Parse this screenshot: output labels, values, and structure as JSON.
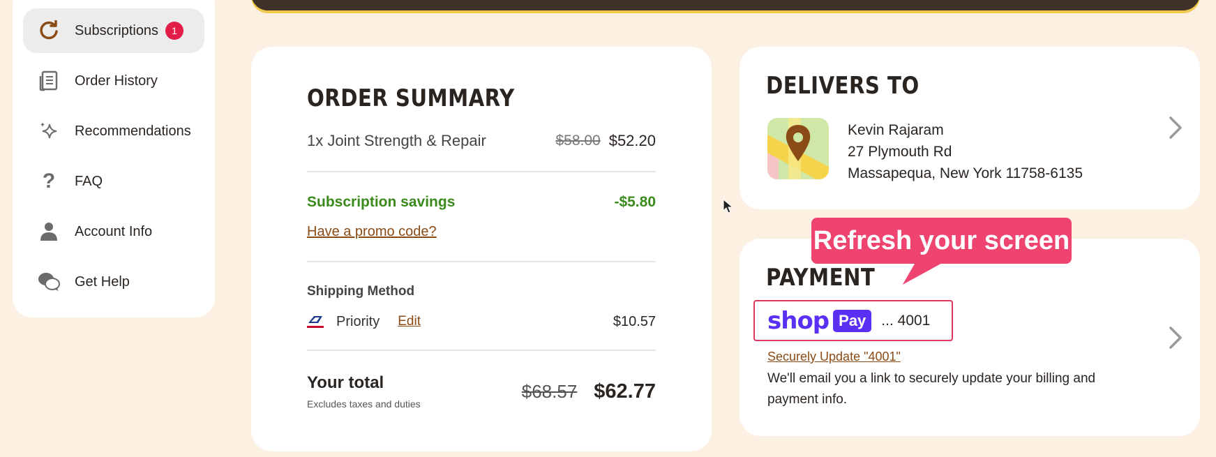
{
  "sidebar": {
    "items": [
      {
        "label": "Subscriptions",
        "icon": "refresh-icon",
        "badge": "1",
        "active": true
      },
      {
        "label": "Order History",
        "icon": "receipt-icon"
      },
      {
        "label": "Recommendations",
        "icon": "sparkles-icon"
      },
      {
        "label": "FAQ",
        "icon": "question-icon"
      },
      {
        "label": "Account Info",
        "icon": "person-icon"
      },
      {
        "label": "Get Help",
        "icon": "chat-icon"
      }
    ]
  },
  "order": {
    "title": "ORDER SUMMARY",
    "item_label": "1x Joint Strength & Repair",
    "item_original": "$58.00",
    "item_price": "$52.20",
    "savings_label": "Subscription savings",
    "savings_value": "-$5.80",
    "promo_link": "Have a promo code?",
    "shipping_heading": "Shipping Method",
    "shipping_method": "Priority",
    "shipping_edit": "Edit",
    "shipping_price": "$10.57",
    "total_label": "Your total",
    "total_note": "Excludes taxes and duties",
    "total_original": "$68.57",
    "total_price": "$62.77"
  },
  "delivery": {
    "title": "DELIVERS TO",
    "name": "Kevin Rajaram",
    "street": "27 Plymouth Rd",
    "city": "Massapequa, New York 11758-6135"
  },
  "payment": {
    "title": "PAYMENT",
    "shop_word": "shop",
    "pay_word": "Pay",
    "card_suffix": "... 4001",
    "update_link": "Securely Update \"4001\"",
    "note": "We'll email you a link to securely update your billing and payment info."
  },
  "tooltip": {
    "text": "Refresh your screen"
  },
  "colors": {
    "background": "#fcf0e2",
    "accent_brown": "#8a4b16",
    "savings_green": "#3a8a1c",
    "badge_red": "#e11d48",
    "tooltip_pink": "#ef4470",
    "shop_purple": "#5a31f4"
  }
}
